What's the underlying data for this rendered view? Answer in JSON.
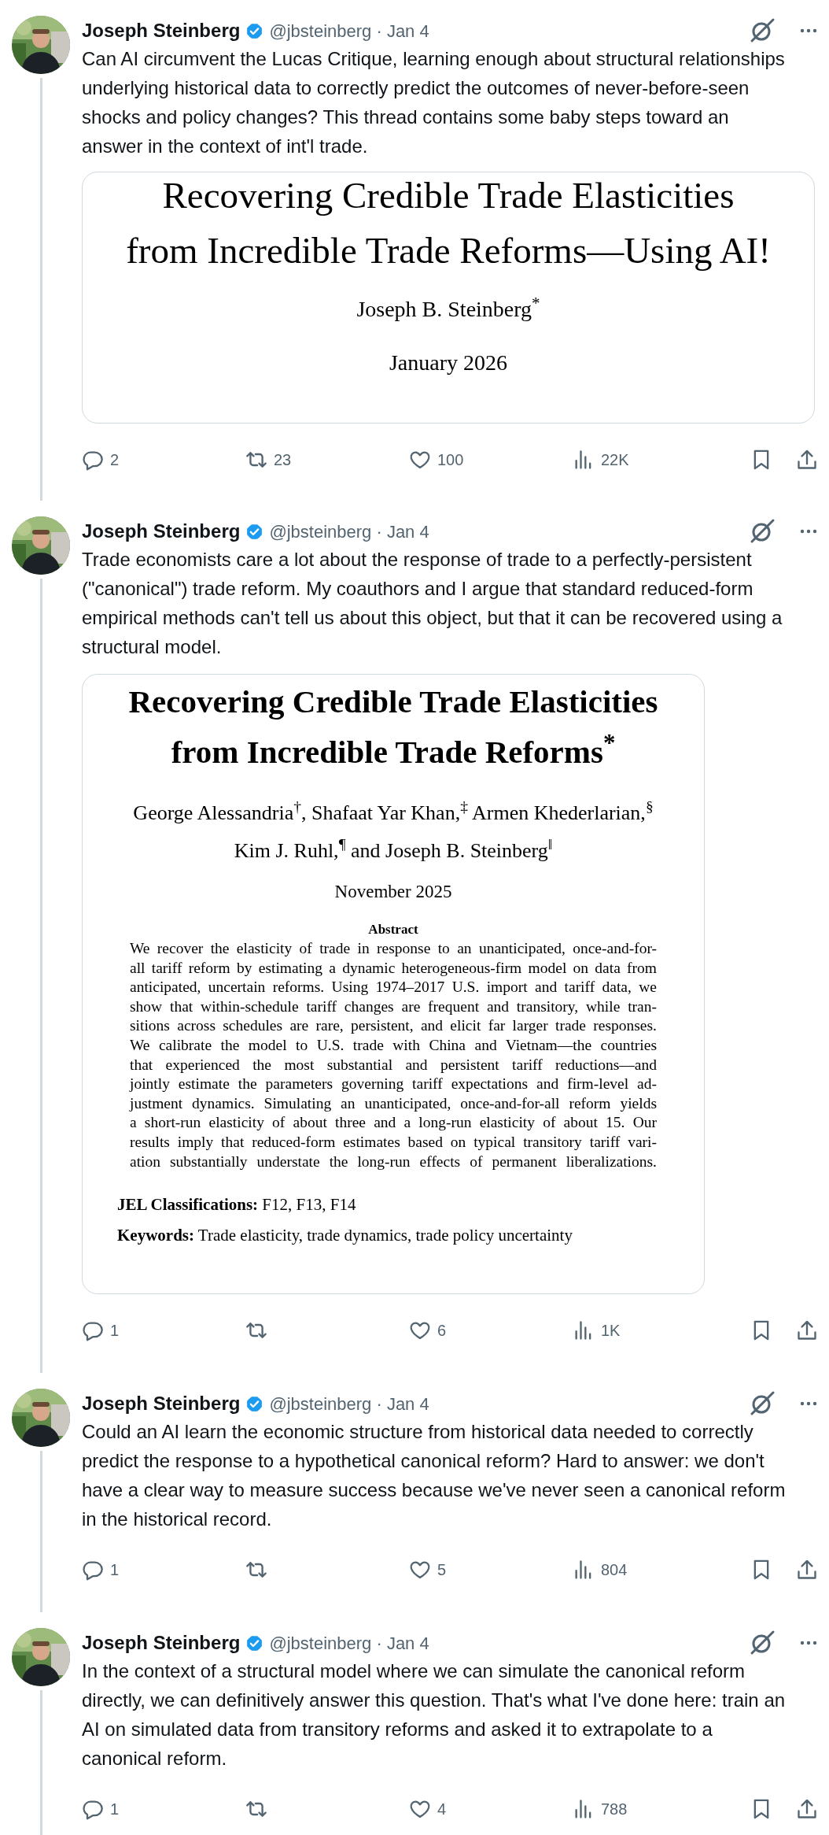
{
  "tweets": [
    {
      "author": {
        "name": "Joseph Steinberg",
        "verified": true,
        "meta": "@jbsteinberg · Jan 4"
      },
      "thread_continues": true,
      "text": "Can AI circumvent the Lucas Critique, learning enough about structural relationships underlying historical data to correctly predict the outcomes of never-before-seen shocks and policy changes? This thread contains some baby steps toward an answer in the context of int'l trade.",
      "media": {
        "kind": "title_page",
        "title_lines": [
          "Recovering Credible Trade Elasticities",
          "from Incredible Trade Reforms—Using AI!"
        ],
        "author": "Joseph B. Steinberg$^{*}$",
        "date": "January 2026"
      },
      "actions": [
        {
          "kind": "reply",
          "count": "2"
        },
        {
          "kind": "repost",
          "count": "23"
        },
        {
          "kind": "like",
          "count": "100"
        },
        {
          "kind": "views",
          "count": "22K"
        },
        {
          "kind": "bookmark"
        },
        {
          "kind": "share"
        }
      ]
    },
    {
      "author": {
        "name": "Joseph Steinberg",
        "verified": true,
        "meta": "@jbsteinberg · Jan 4"
      },
      "thread_continues": true,
      "text": "Trade economists care a lot about the response of trade to a perfectly-persistent (\"canonical\") trade reform. My coauthors and I argue that standard reduced-form empirical methods can't tell us about this object, but that it can be recovered using a structural model.",
      "media": {
        "kind": "abstract_page",
        "title_lines": [
          "Recovering Credible Trade Elasticities",
          "from Incredible Trade Reforms$^{*}$"
        ],
        "author_lines": [
          "George Alessandria$^{†}$, Shafaat Yar Khan,$^{‡}$ Armen Khederlarian,$^{§}$",
          "Kim J. Ruhl,$^{¶}$ and Joseph B. Steinberg$^{‖}$"
        ],
        "date": "November 2025",
        "abstract_heading": "Abstract",
        "abstract_lines": [
          "We recover the elasticity of trade in response to an unanticipated, once-and-for-",
          "all tariff reform by estimating a dynamic heterogeneous-firm model on data from",
          "anticipated, uncertain reforms. Using 1974–2017 U.S. import and tariff data, we",
          "show that within-schedule tariff changes are frequent and transitory, while tran-",
          "sitions across schedules are rare, persistent, and elicit far larger trade responses.",
          "We calibrate the model to U.S. trade with China and Vietnam—the countries",
          "that experienced the most substantial and persistent tariff reductions—and",
          "jointly estimate the parameters governing tariff expectations and firm-level ad-",
          "justment dynamics. Simulating an unanticipated, once-and-for-all reform yields",
          "a short-run elasticity of about three and a long-run elasticity of about 15. Our",
          "results imply that reduced-form estimates based on typical transitory tariff vari-",
          "ation substantially understate the long-run effects of permanent liberalizations."
        ],
        "jel": "**JEL Classifications:** F12, F13, F14",
        "keywords": "**Keywords:** Trade elasticity, trade dynamics, trade policy uncertainty"
      },
      "actions": [
        {
          "kind": "reply",
          "count": "1"
        },
        {
          "kind": "repost"
        },
        {
          "kind": "like",
          "count": "6"
        },
        {
          "kind": "views",
          "count": "1K"
        },
        {
          "kind": "bookmark"
        },
        {
          "kind": "share"
        }
      ]
    },
    {
      "author": {
        "name": "Joseph Steinberg",
        "verified": true,
        "meta": "@jbsteinberg · Jan 4"
      },
      "thread_continues": true,
      "text": "Could an AI learn the economic structure from historical data needed to correctly predict the response to a hypothetical canonical reform? Hard to answer: we don't have a clear way to measure success because we've never seen a canonical reform in the historical record.",
      "actions": [
        {
          "kind": "reply",
          "count": "1"
        },
        {
          "kind": "repost"
        },
        {
          "kind": "like",
          "count": "5"
        },
        {
          "kind": "views",
          "count": "804"
        },
        {
          "kind": "bookmark"
        },
        {
          "kind": "share"
        }
      ]
    },
    {
      "author": {
        "name": "Joseph Steinberg",
        "verified": true,
        "meta": "@jbsteinberg · Jan 4"
      },
      "thread_continues": true,
      "text": "In the context of a structural model where we can simulate the canonical reform directly, we can definitively answer this question. That's what I've done here: train an AI on simulated data from transitory reforms and asked it to extrapolate to a canonical reform.",
      "actions": [
        {
          "kind": "reply",
          "count": "1"
        },
        {
          "kind": "repost"
        },
        {
          "kind": "like",
          "count": "4"
        },
        {
          "kind": "views",
          "count": "788"
        },
        {
          "kind": "bookmark"
        },
        {
          "kind": "share"
        }
      ]
    }
  ]
}
